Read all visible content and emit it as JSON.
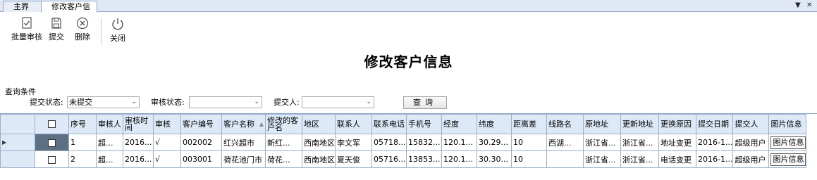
{
  "tabs": [
    {
      "label": "主界面"
    },
    {
      "label": "修改客户信息"
    }
  ],
  "tab_controls": {
    "dropdown": "▼",
    "close": "✕"
  },
  "toolbar": {
    "batch_review": "批量审核",
    "submit": "提交",
    "delete": "删除",
    "close": "关闭"
  },
  "page_title": "修改客户信息",
  "query": {
    "group_label": "查询条件",
    "submit_status_label": "提交状态:",
    "submit_status_value": "未提交",
    "review_status_label": "审核状态:",
    "review_status_value": "",
    "submitter_label": "提交人:",
    "submitter_value": "",
    "query_button": "查询"
  },
  "grid": {
    "columns": [
      "序号",
      "审核人",
      "审核时间",
      "审核",
      "客户编号",
      "客户名称",
      "修改的客户名",
      "地区",
      "联系人",
      "联系电话",
      "手机号",
      "经度",
      "纬度",
      "距离差",
      "线路名",
      "原地址",
      "更新地址",
      "更换原因",
      "提交日期",
      "提交人",
      "图片信息"
    ],
    "rows": [
      {
        "seq": "1",
        "reviewer": "超...",
        "review_time": "2016...",
        "reviewed": "√",
        "customer_no": "002002",
        "customer_name": "红兴超市",
        "new_name": "新红...",
        "region": "西南地区",
        "contact": "李文军",
        "phone": "05718...",
        "mobile": "15832...",
        "lng": "120.1...",
        "lat": "30.29...",
        "distance": "10",
        "route": "西湖...",
        "old_addr": "浙江省...",
        "new_addr": "浙江省...",
        "reason": "地址变更",
        "submit_date": "2016-1...",
        "submitter": "超级用户",
        "image": "图片信息"
      },
      {
        "seq": "2",
        "reviewer": "超...",
        "review_time": "2016...",
        "reviewed": "√",
        "customer_no": "003001",
        "customer_name": "荷花池门市",
        "new_name": "荷花...",
        "region": "西南地区",
        "contact": "夏天俊",
        "phone": "05716...",
        "mobile": "13853...",
        "lng": "120.1...",
        "lat": "30.30...",
        "distance": "10",
        "route": "",
        "old_addr": "浙江省...",
        "new_addr": "浙江省...",
        "reason": "电话变更",
        "submit_date": "2016-1...",
        "submitter": "超级用户",
        "image": "图片信息"
      }
    ]
  },
  "colors": {
    "header_bg": "#dde9f7",
    "border": "#9ab0cc",
    "selected_cell": "#5d6f82"
  }
}
